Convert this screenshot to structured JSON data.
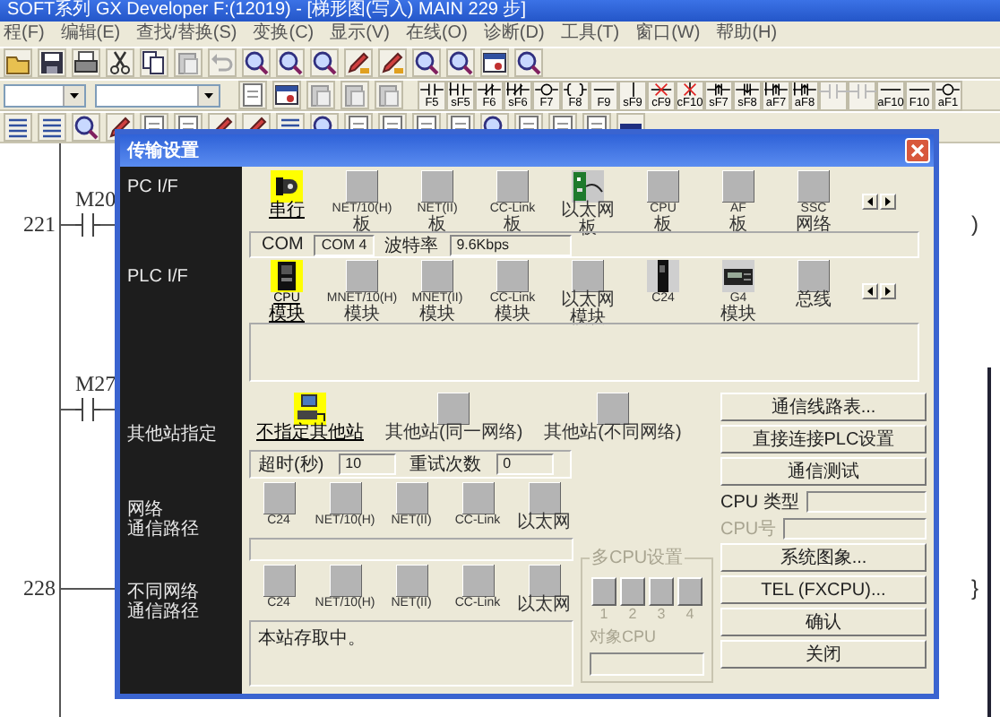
{
  "app": {
    "title": "SOFT系列 GX Developer F:(12019) - [梯形图(写入)    MAIN    229 步]"
  },
  "menu": [
    "程(F)",
    "编辑(E)",
    "查找/替换(S)",
    "变换(C)",
    "显示(V)",
    "在线(O)",
    "诊断(D)",
    "工具(T)",
    "窗口(W)",
    "帮助(H)"
  ],
  "function_keys": [
    {
      "kind": "contact",
      "label": "F5"
    },
    {
      "kind": "contact_parallel",
      "label": "sF5"
    },
    {
      "kind": "nc_contact",
      "label": "F6"
    },
    {
      "kind": "nc_parallel",
      "label": "sF6"
    },
    {
      "kind": "coil",
      "label": "F7"
    },
    {
      "kind": "instruction",
      "label": "F8"
    },
    {
      "kind": "hline",
      "label": "F9"
    },
    {
      "kind": "vline",
      "label": "sF9"
    },
    {
      "kind": "delete_h",
      "label": "cF9"
    },
    {
      "kind": "delete_v",
      "label": "cF10"
    },
    {
      "kind": "pulse",
      "label": "sF7"
    },
    {
      "kind": "pulse_falling",
      "label": "sF8"
    },
    {
      "kind": "pulse_parallel",
      "label": "aF7"
    },
    {
      "kind": "pulse_parallel",
      "label": "aF8"
    },
    {
      "kind": "disabled"
    },
    {
      "kind": "disabled"
    },
    {
      "kind": "hline",
      "label": "aF10"
    },
    {
      "kind": "hline",
      "label": "F10"
    },
    {
      "kind": "coil",
      "label": "aF1"
    }
  ],
  "ladder": {
    "rungs": [
      {
        "step": "221",
        "device": "M20",
        "end": ")"
      },
      {
        "device": "M27"
      },
      {
        "step": "228",
        "end": "}"
      }
    ]
  },
  "dialog": {
    "title": "传输设置",
    "pc_if": {
      "label": "PC I/F",
      "options": [
        {
          "kind": "serial",
          "lines": [
            "串行"
          ],
          "selected": true
        },
        {
          "kind": "board",
          "lines": [
            "NET/10(H)",
            "板"
          ],
          "selected": false
        },
        {
          "kind": "board",
          "lines": [
            "NET(II)",
            "板"
          ],
          "selected": false
        },
        {
          "kind": "board",
          "lines": [
            "CC-Link",
            "板"
          ],
          "selected": false
        },
        {
          "kind": "ethernet",
          "lines": [
            "以太网",
            "板"
          ],
          "selected": false
        },
        {
          "kind": "board",
          "lines": [
            "CPU",
            "板"
          ],
          "selected": false
        },
        {
          "kind": "board",
          "lines": [
            "AF",
            "板"
          ],
          "selected": false
        },
        {
          "kind": "board",
          "lines": [
            "SSC",
            "网络"
          ],
          "selected": false
        }
      ],
      "port_label": "COM",
      "port": "COM 4",
      "baud_label": "波特率",
      "baud": "9.6Kbps"
    },
    "plc_if": {
      "label": "PLC I/F",
      "options": [
        {
          "kind": "cpu",
          "lines": [
            "CPU",
            "模块"
          ],
          "selected": true
        },
        {
          "kind": "board",
          "lines": [
            "MNET/10(H)",
            "模块"
          ],
          "selected": false
        },
        {
          "kind": "board",
          "lines": [
            "MNET(II)",
            "模块"
          ],
          "selected": false
        },
        {
          "kind": "board",
          "lines": [
            "CC-Link",
            "模块"
          ],
          "selected": false
        },
        {
          "kind": "board",
          "lines": [
            "以太网",
            "模块"
          ],
          "selected": false
        },
        {
          "kind": "c24",
          "lines": [
            "C24"
          ],
          "selected": false
        },
        {
          "kind": "g4",
          "lines": [
            "G4",
            "模块"
          ],
          "selected": false
        },
        {
          "kind": "board",
          "lines": [
            "总线"
          ],
          "selected": false
        }
      ]
    },
    "other_station": {
      "label": "其他站指定",
      "options": [
        {
          "kind": "station",
          "lines": [
            "不指定其他站"
          ],
          "selected": true
        },
        {
          "kind": "board",
          "lines": [
            "其他站(同一网络)"
          ],
          "selected": false
        },
        {
          "kind": "board",
          "lines": [
            "其他站(不同网络)"
          ],
          "selected": false
        }
      ],
      "timeout_label": "超时(秒)",
      "timeout": "10",
      "retry_label": "重试次数",
      "retry": "0"
    },
    "network_route": {
      "label_lines": [
        "网络",
        "通信路径"
      ],
      "options": [
        {
          "kind": "board",
          "lines": [
            "C24"
          ],
          "selected": false
        },
        {
          "kind": "board",
          "lines": [
            "NET/10(H)"
          ],
          "selected": false
        },
        {
          "kind": "board",
          "lines": [
            "NET(II)"
          ],
          "selected": false
        },
        {
          "kind": "board",
          "lines": [
            "CC-Link"
          ],
          "selected": false
        },
        {
          "kind": "board",
          "lines": [
            "以太网"
          ],
          "selected": false
        }
      ]
    },
    "other_network_route": {
      "label_lines": [
        "不同网络",
        "通信路径"
      ],
      "options": [
        {
          "kind": "board",
          "lines": [
            "C24"
          ],
          "selected": false
        },
        {
          "kind": "board",
          "lines": [
            "NET/10(H)"
          ],
          "selected": false
        },
        {
          "kind": "board",
          "lines": [
            "NET(II)"
          ],
          "selected": false
        },
        {
          "kind": "board",
          "lines": [
            "CC-Link"
          ],
          "selected": false
        },
        {
          "kind": "board",
          "lines": [
            "以太网"
          ],
          "selected": false
        }
      ],
      "message": "本站存取中。"
    },
    "multi_cpu": {
      "title": "多CPU设置",
      "slots": [
        "1",
        "2",
        "3",
        "4"
      ],
      "target_label": "对象CPU",
      "disabled": true
    },
    "side_panel": [
      {
        "kind": "button",
        "label": "通信线路表..."
      },
      {
        "kind": "button",
        "label": "直接连接PLC设置"
      },
      {
        "kind": "button",
        "label": "通信测试"
      },
      {
        "kind": "field",
        "label": "CPU 类型",
        "disabled": false
      },
      {
        "kind": "field",
        "label": "CPU号",
        "disabled": true
      },
      {
        "kind": "button",
        "label": "系统图象..."
      },
      {
        "kind": "button",
        "label": "TEL (FXCPU)..."
      },
      {
        "kind": "button",
        "label": "确认"
      },
      {
        "kind": "button",
        "label": "关闭"
      }
    ]
  }
}
